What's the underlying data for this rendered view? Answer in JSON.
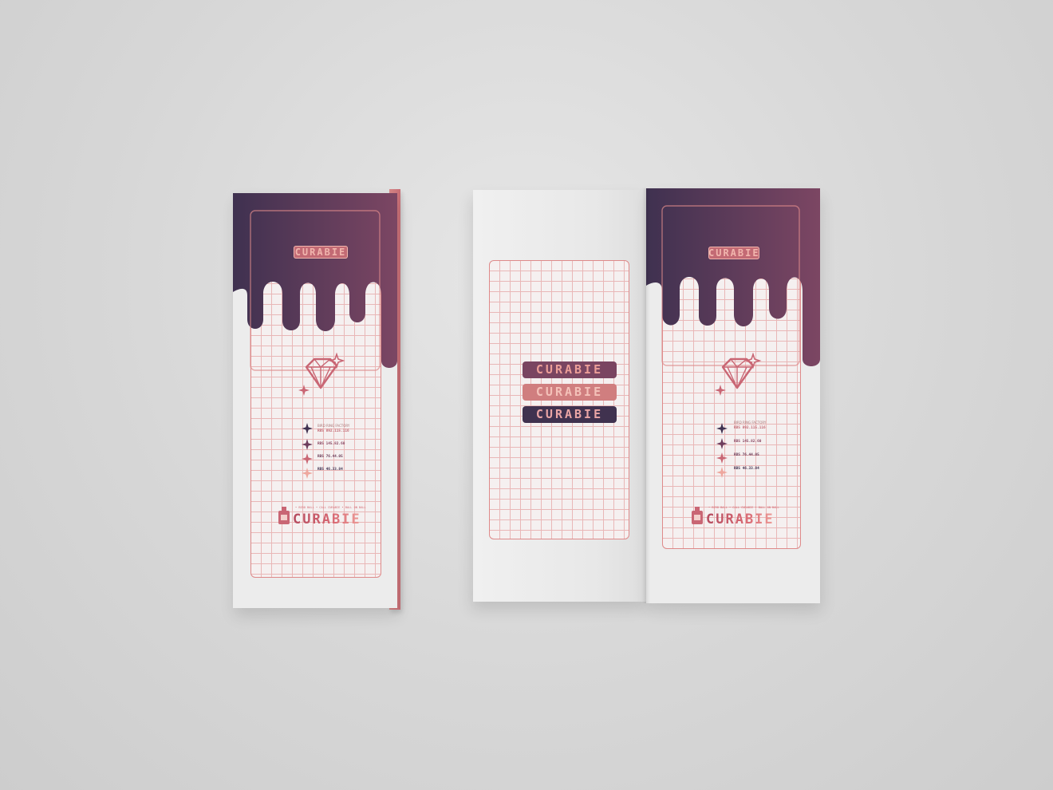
{
  "brand": {
    "name": "CURABIE",
    "stack": [
      "CURABIE",
      "CURABIE",
      "CURABIE"
    ],
    "tagline": "• BIRD BALL • CALL CURABIE • BALL ON BALL"
  },
  "price_list": {
    "header": "BIRD RING FACTORY",
    "items": [
      "RBS 892.115.116",
      "RBS 145.82.60",
      "RBS 76.44.05",
      "RBS 46.33.84"
    ]
  },
  "colors": {
    "background": "#d6d6d6",
    "paper": "#ececec",
    "drip_dark": "#3f3150",
    "drip_light": "#7c4663",
    "grid_line": "#de8a8a",
    "accent_pink": "#c36a74",
    "accent_light": "#eea79e"
  },
  "icons": [
    "diamond-icon",
    "sparkle-icon",
    "bottle-icon"
  ]
}
